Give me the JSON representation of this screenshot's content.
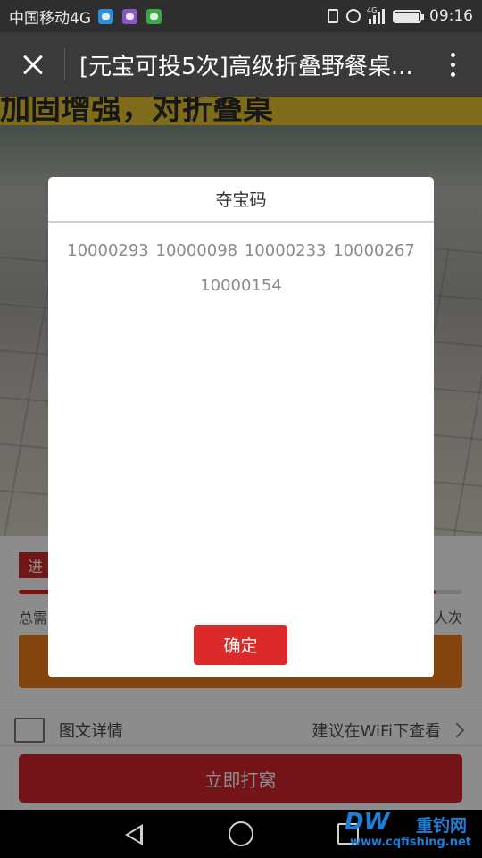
{
  "status_bar": {
    "carrier": "中国移动4G",
    "network_label": "4G",
    "time": "09:16",
    "notification_icons": [
      "chat-bubble-icon",
      "photo-app-icon",
      "wechat-icon"
    ]
  },
  "title_bar": {
    "title": "[元宝可投5次]高级折叠野餐桌..."
  },
  "page": {
    "photo_banner": "加固增强，对折叠桌",
    "progress_tag": "进",
    "progress_fraction": 0.94,
    "total_need_label": "总需",
    "remaining_label": "人次",
    "detail_label": "图文详情",
    "wifi_hint": "建议在WiFi下查看",
    "buy_button": "立即打窝"
  },
  "modal": {
    "title": "夺宝码",
    "codes": [
      "10000293",
      "10000098",
      "10000233",
      "10000267",
      "10000154"
    ],
    "confirm_label": "确定"
  },
  "watermark": {
    "logo": "DW",
    "brand": "重钓网",
    "url": "www.cqfishing.net"
  },
  "colors": {
    "accent_red": "#dc2a2a",
    "orange": "#f07d1a",
    "title_bar": "#3a3a3a"
  }
}
